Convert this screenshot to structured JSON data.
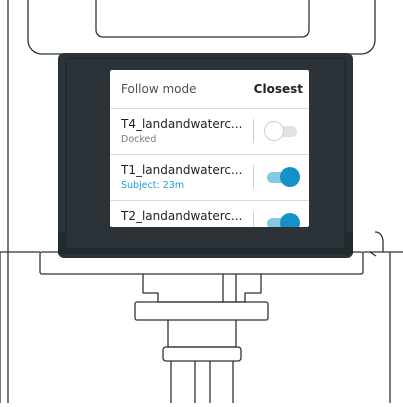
{
  "follow_mode": {
    "label": "Follow mode",
    "value": "Closest"
  },
  "targets": [
    {
      "name": "T4_landandwaterc...",
      "status": "Docked",
      "enabled": false
    },
    {
      "name": "T1_landandwaterc...",
      "status": "Subject: 23m",
      "enabled": true
    },
    {
      "name": "T2_landandwaterc...",
      "status": "",
      "enabled": true
    }
  ],
  "colors": {
    "accent": "#1590c8",
    "status_active": "#1aa1d6",
    "device_frame": "#2b3338"
  },
  "icons": [
    "device-illustration"
  ]
}
